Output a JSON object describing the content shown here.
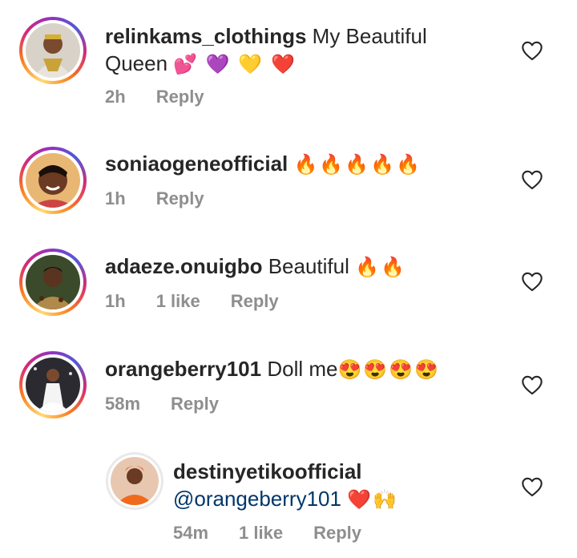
{
  "comments": [
    {
      "username": "relinkams_clothings",
      "text": "My Beautiful Queen",
      "emoji": "💕 💜 💛 ❤️",
      "time": "2h",
      "likes": "",
      "reply": "Reply"
    },
    {
      "username": "soniaogeneofficial",
      "text": "",
      "emoji": "🔥🔥🔥🔥🔥",
      "time": "1h",
      "likes": "",
      "reply": "Reply"
    },
    {
      "username": "adaeze.onuigbo",
      "text": "Beautiful",
      "emoji": "🔥🔥",
      "time": "1h",
      "likes": "1 like",
      "reply": "Reply"
    },
    {
      "username": "orangeberry101",
      "text": "Doll me",
      "emoji": "😍😍😍😍",
      "time": "58m",
      "likes": "",
      "reply": "Reply"
    }
  ],
  "reply_comment": {
    "username": "destinyetikoofficial",
    "mention": "@orangeberry101",
    "emoji": "❤️🙌",
    "time": "54m",
    "likes": "1 like",
    "reply": "Reply"
  },
  "icons": {
    "like": "heart-outline-icon"
  },
  "colors": {
    "username": "#262626",
    "meta": "#8e8e8e",
    "mention": "#00376b"
  }
}
